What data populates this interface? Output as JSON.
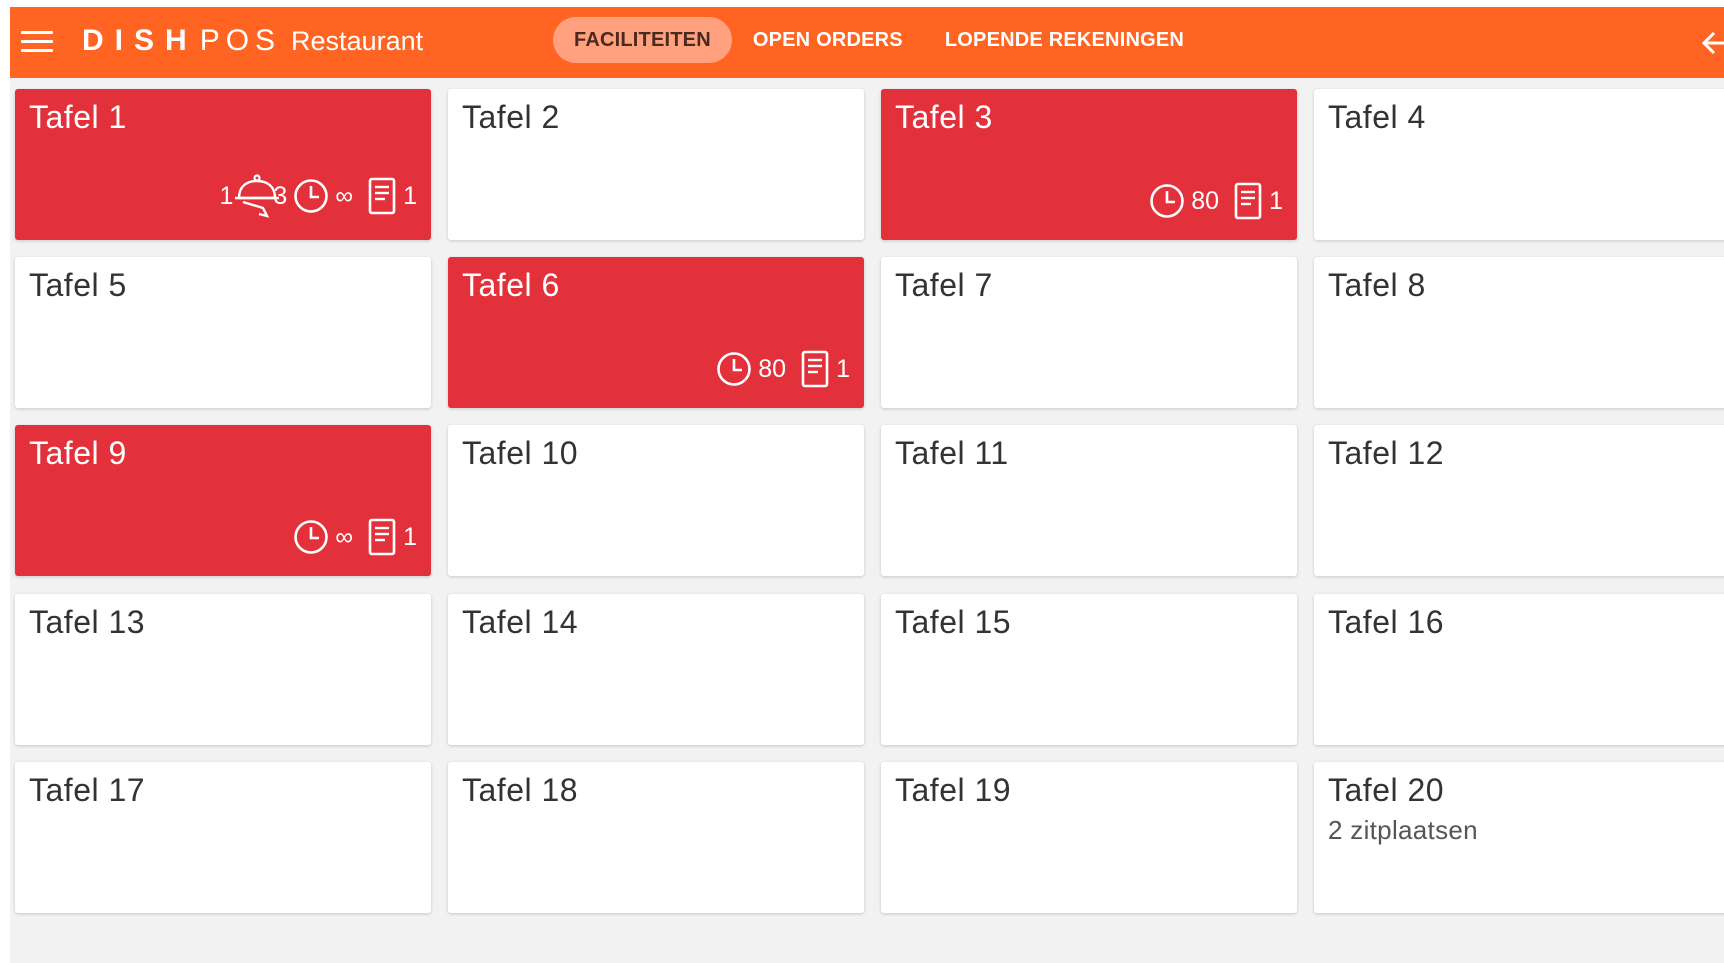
{
  "header": {
    "brand_bold": "DISH",
    "brand_light": "POS",
    "brand_sub": "Restaurant",
    "accent_color": "#ff6422",
    "tabs": [
      {
        "label": "FACILITEITEN",
        "active": true
      },
      {
        "label": "OPEN ORDERS",
        "active": false
      },
      {
        "label": "LOPENDE REKENINGEN",
        "active": false
      }
    ],
    "menu_icon": "hamburger-icon",
    "exit_icon": "exit-icon"
  },
  "tables": [
    {
      "name": "Tafel 1",
      "occupied": true,
      "status": {
        "waiter_count": "1",
        "guests": "3",
        "time": "∞",
        "orders": "1"
      }
    },
    {
      "name": "Tafel 2",
      "occupied": false
    },
    {
      "name": "Tafel 3",
      "occupied": true,
      "status": {
        "time": "80",
        "orders": "1"
      }
    },
    {
      "name": "Tafel 4",
      "occupied": false
    },
    {
      "name": "Tafel 5",
      "occupied": false
    },
    {
      "name": "Tafel 6",
      "occupied": true,
      "status": {
        "time": "80",
        "orders": "1"
      }
    },
    {
      "name": "Tafel 7",
      "occupied": false
    },
    {
      "name": "Tafel 8",
      "occupied": false
    },
    {
      "name": "Tafel 9",
      "occupied": true,
      "status": {
        "time": "∞",
        "orders": "1"
      }
    },
    {
      "name": "Tafel 10",
      "occupied": false
    },
    {
      "name": "Tafel 11",
      "occupied": false
    },
    {
      "name": "Tafel 12",
      "occupied": false
    },
    {
      "name": "Tafel 13",
      "occupied": false
    },
    {
      "name": "Tafel 14",
      "occupied": false
    },
    {
      "name": "Tafel 15",
      "occupied": false
    },
    {
      "name": "Tafel 16",
      "occupied": false
    },
    {
      "name": "Tafel 17",
      "occupied": false
    },
    {
      "name": "Tafel 18",
      "occupied": false
    },
    {
      "name": "Tafel 19",
      "occupied": false
    },
    {
      "name": "Tafel 20",
      "occupied": false,
      "subtitle": "2 zitplaatsen"
    }
  ],
  "colors": {
    "occupied": "#e3313b",
    "free": "#ffffff",
    "background": "#f2f2f2"
  }
}
